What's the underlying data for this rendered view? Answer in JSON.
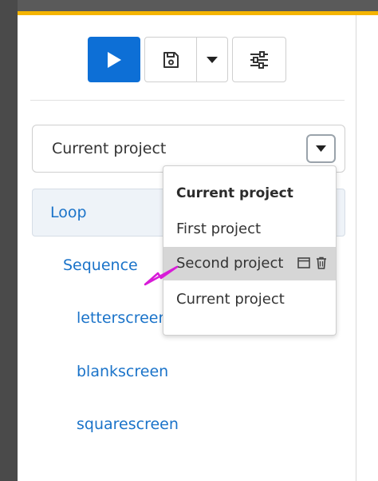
{
  "toolbar": {
    "play_icon": "play-icon",
    "save_icon": "floppy-save-icon",
    "save_menu_icon": "caret-down-icon",
    "settings_icon": "sliders-icon",
    "accent_color": "#0d6fd6"
  },
  "project_select": {
    "value": "Current project",
    "toggle_icon": "caret-down-icon"
  },
  "dropdown": {
    "header": "Current project",
    "items": [
      {
        "label": "First project"
      },
      {
        "label": "Second project",
        "highlighted": true,
        "actions": [
          "window-icon",
          "trash-icon"
        ]
      },
      {
        "label": "Current project"
      }
    ]
  },
  "tree": {
    "root": "Loop",
    "child": "Sequence",
    "leaves": [
      "letterscreen",
      "blankscreen",
      "squarescreen"
    ]
  },
  "colors": {
    "top_accent": "#f4b400",
    "link": "#1a73c9",
    "cursor": "#d81bd8"
  }
}
